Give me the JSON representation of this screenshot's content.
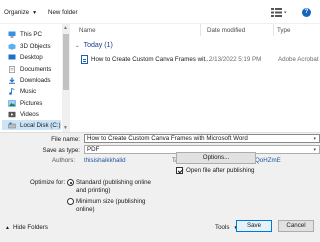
{
  "toolbar": {
    "organize_label": "Organize",
    "new_folder_label": "New folder",
    "view_icon": "view-options-icon",
    "help_label": "?"
  },
  "nav": {
    "items": [
      {
        "label": "This PC",
        "icon": "computer-icon",
        "selected": false
      },
      {
        "label": "3D Objects",
        "icon": "cube-icon",
        "selected": false
      },
      {
        "label": "Desktop",
        "icon": "desktop-icon",
        "selected": false
      },
      {
        "label": "Documents",
        "icon": "document-icon",
        "selected": false
      },
      {
        "label": "Downloads",
        "icon": "download-icon",
        "selected": false
      },
      {
        "label": "Music",
        "icon": "music-icon",
        "selected": false
      },
      {
        "label": "Pictures",
        "icon": "picture-icon",
        "selected": false
      },
      {
        "label": "Videos",
        "icon": "video-icon",
        "selected": false
      },
      {
        "label": "Local Disk (C:)",
        "icon": "drive-icon",
        "selected": true
      }
    ]
  },
  "files": {
    "columns": [
      "Name",
      "Date modified",
      "Type"
    ],
    "group_label": "Today (1)",
    "rows": [
      {
        "name": "How to Create Custom Canva Frames wit...",
        "date": "2/13/2022 5:19 PM",
        "type": "Adobe Acrobat"
      }
    ]
  },
  "form": {
    "file_name_label": "File name:",
    "file_name_value": "How to Create Custom Canva Frames with Microsoft Word",
    "save_type_label": "Save as type:",
    "save_type_value": "PDF",
    "authors_label": "Authors:",
    "authors_value": "thisishaikkhalid",
    "tags_label": "Tags:",
    "tags_value": "DAE4PEnDLX8,BABzRQoHZmE",
    "optimize_label": "Optimize for:",
    "radio_standard": "Standard (publishing online and printing)",
    "radio_minimum": "Minimum size (publishing online)",
    "options_button": "Options...",
    "open_after_label": "Open file after publishing"
  },
  "footer": {
    "hide_folders_label": "Hide Folders",
    "tools_label": "Tools",
    "save_button": "Save",
    "cancel_button": "Cancel"
  },
  "colors": {
    "accent": "#0078d7",
    "selection": "#cce4f7"
  }
}
